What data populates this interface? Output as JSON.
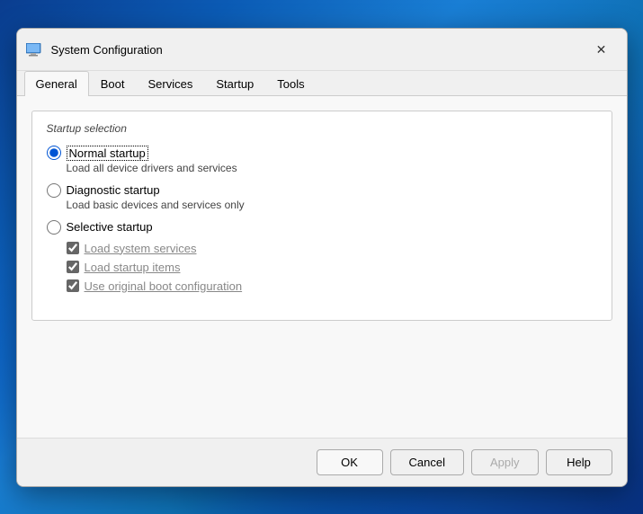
{
  "dialog": {
    "title": "System Configuration",
    "icon": "⚙",
    "tabs": [
      {
        "id": "general",
        "label": "General",
        "active": true
      },
      {
        "id": "boot",
        "label": "Boot",
        "active": false
      },
      {
        "id": "services",
        "label": "Services",
        "active": false
      },
      {
        "id": "startup",
        "label": "Startup",
        "active": false
      },
      {
        "id": "tools",
        "label": "Tools",
        "active": false
      }
    ]
  },
  "content": {
    "group_label": "Startup selection",
    "options": [
      {
        "id": "normal",
        "label": "Normal startup",
        "description": "Load all device drivers and services",
        "selected": true
      },
      {
        "id": "diagnostic",
        "label": "Diagnostic startup",
        "description": "Load basic devices and services only",
        "selected": false
      },
      {
        "id": "selective",
        "label": "Selective startup",
        "selected": false
      }
    ],
    "checkboxes": [
      {
        "id": "load_system",
        "label": "Load system services",
        "checked": true
      },
      {
        "id": "load_startup",
        "label": "Load startup items",
        "checked": true
      },
      {
        "id": "use_original",
        "label": "Use original boot configuration",
        "checked": true
      }
    ]
  },
  "footer": {
    "ok": "OK",
    "cancel": "Cancel",
    "apply": "Apply",
    "help": "Help"
  }
}
